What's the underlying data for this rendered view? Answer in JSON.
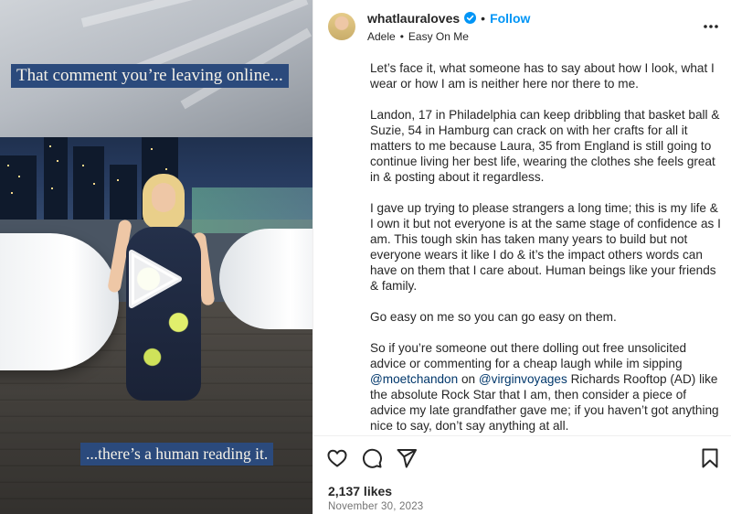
{
  "media": {
    "caption_top": "That comment you’re leaving online...",
    "caption_bottom": "...there’s a human reading it.",
    "play_icon": "play-icon"
  },
  "header": {
    "username": "whatlauraloves",
    "verified_icon": "verified-badge-icon",
    "separator": "•",
    "follow_label": "Follow",
    "audio_artist": "Adele",
    "audio_separator": "•",
    "audio_track": "Easy On Me",
    "more_icon": "more-options-icon"
  },
  "caption": {
    "partial_top": "",
    "p1": "Let’s face it, what someone has to say about how I look, what I wear or how I am is neither here nor there to me.",
    "p2": "Landon, 17 in Philadelphia can keep dribbling that basket ball & Suzie, 54 in Hamburg can crack on with her crafts for all it matters to me because Laura, 35 from England is still going to continue living her best life, wearing the clothes she feels great in & posting about it regardless.",
    "p3": "I gave up trying to please strangers a long time; this is my life & I own it but not everyone is at the same stage of confidence as I am. This tough skin has taken many years to build but not everyone wears it like I do & it’s the impact others words can have on them that I care about. Human beings like your friends & family.",
    "p4": "Go easy on me so you can go easy on them.",
    "p5_a": "So if you’re someone out there dolling out free unsolicited advice or commenting for a cheap laugh while im sipping ",
    "p5_mention1": "@moetchandon",
    "p5_b": " on ",
    "p5_mention2": "@virginvoyages",
    "p5_c": " Richards Rooftop (AD) like the absolute Rock Star that I am, then consider a piece of advice my late grandfather gave me; if you haven’t got anything nice to say, don’t say anything at all."
  },
  "actions": {
    "like_icon": "heart-icon",
    "comment_icon": "comment-icon",
    "share_icon": "share-icon",
    "save_icon": "bookmark-icon",
    "likes": "2,137 likes",
    "date": "November 30, 2023"
  },
  "colors": {
    "accent": "#0095f6",
    "mention": "#00376b",
    "caption_bg": "#2b4a7c"
  }
}
